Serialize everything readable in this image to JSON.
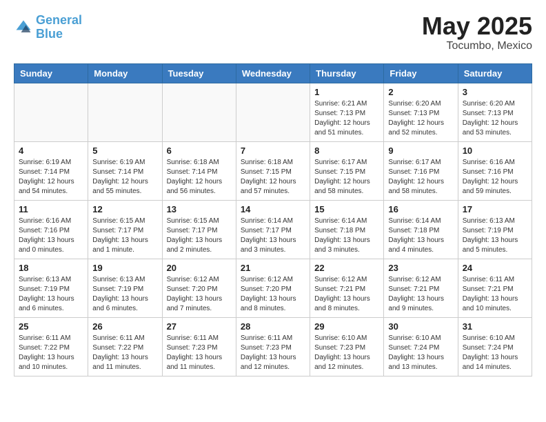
{
  "header": {
    "logo_line1": "General",
    "logo_line2": "Blue",
    "month": "May 2025",
    "location": "Tocumbo, Mexico"
  },
  "weekdays": [
    "Sunday",
    "Monday",
    "Tuesday",
    "Wednesday",
    "Thursday",
    "Friday",
    "Saturday"
  ],
  "weeks": [
    [
      {
        "day": "",
        "info": ""
      },
      {
        "day": "",
        "info": ""
      },
      {
        "day": "",
        "info": ""
      },
      {
        "day": "",
        "info": ""
      },
      {
        "day": "1",
        "info": "Sunrise: 6:21 AM\nSunset: 7:13 PM\nDaylight: 12 hours\nand 51 minutes."
      },
      {
        "day": "2",
        "info": "Sunrise: 6:20 AM\nSunset: 7:13 PM\nDaylight: 12 hours\nand 52 minutes."
      },
      {
        "day": "3",
        "info": "Sunrise: 6:20 AM\nSunset: 7:13 PM\nDaylight: 12 hours\nand 53 minutes."
      }
    ],
    [
      {
        "day": "4",
        "info": "Sunrise: 6:19 AM\nSunset: 7:14 PM\nDaylight: 12 hours\nand 54 minutes."
      },
      {
        "day": "5",
        "info": "Sunrise: 6:19 AM\nSunset: 7:14 PM\nDaylight: 12 hours\nand 55 minutes."
      },
      {
        "day": "6",
        "info": "Sunrise: 6:18 AM\nSunset: 7:14 PM\nDaylight: 12 hours\nand 56 minutes."
      },
      {
        "day": "7",
        "info": "Sunrise: 6:18 AM\nSunset: 7:15 PM\nDaylight: 12 hours\nand 57 minutes."
      },
      {
        "day": "8",
        "info": "Sunrise: 6:17 AM\nSunset: 7:15 PM\nDaylight: 12 hours\nand 58 minutes."
      },
      {
        "day": "9",
        "info": "Sunrise: 6:17 AM\nSunset: 7:16 PM\nDaylight: 12 hours\nand 58 minutes."
      },
      {
        "day": "10",
        "info": "Sunrise: 6:16 AM\nSunset: 7:16 PM\nDaylight: 12 hours\nand 59 minutes."
      }
    ],
    [
      {
        "day": "11",
        "info": "Sunrise: 6:16 AM\nSunset: 7:16 PM\nDaylight: 13 hours\nand 0 minutes."
      },
      {
        "day": "12",
        "info": "Sunrise: 6:15 AM\nSunset: 7:17 PM\nDaylight: 13 hours\nand 1 minute."
      },
      {
        "day": "13",
        "info": "Sunrise: 6:15 AM\nSunset: 7:17 PM\nDaylight: 13 hours\nand 2 minutes."
      },
      {
        "day": "14",
        "info": "Sunrise: 6:14 AM\nSunset: 7:17 PM\nDaylight: 13 hours\nand 3 minutes."
      },
      {
        "day": "15",
        "info": "Sunrise: 6:14 AM\nSunset: 7:18 PM\nDaylight: 13 hours\nand 3 minutes."
      },
      {
        "day": "16",
        "info": "Sunrise: 6:14 AM\nSunset: 7:18 PM\nDaylight: 13 hours\nand 4 minutes."
      },
      {
        "day": "17",
        "info": "Sunrise: 6:13 AM\nSunset: 7:19 PM\nDaylight: 13 hours\nand 5 minutes."
      }
    ],
    [
      {
        "day": "18",
        "info": "Sunrise: 6:13 AM\nSunset: 7:19 PM\nDaylight: 13 hours\nand 6 minutes."
      },
      {
        "day": "19",
        "info": "Sunrise: 6:13 AM\nSunset: 7:19 PM\nDaylight: 13 hours\nand 6 minutes."
      },
      {
        "day": "20",
        "info": "Sunrise: 6:12 AM\nSunset: 7:20 PM\nDaylight: 13 hours\nand 7 minutes."
      },
      {
        "day": "21",
        "info": "Sunrise: 6:12 AM\nSunset: 7:20 PM\nDaylight: 13 hours\nand 8 minutes."
      },
      {
        "day": "22",
        "info": "Sunrise: 6:12 AM\nSunset: 7:21 PM\nDaylight: 13 hours\nand 8 minutes."
      },
      {
        "day": "23",
        "info": "Sunrise: 6:12 AM\nSunset: 7:21 PM\nDaylight: 13 hours\nand 9 minutes."
      },
      {
        "day": "24",
        "info": "Sunrise: 6:11 AM\nSunset: 7:21 PM\nDaylight: 13 hours\nand 10 minutes."
      }
    ],
    [
      {
        "day": "25",
        "info": "Sunrise: 6:11 AM\nSunset: 7:22 PM\nDaylight: 13 hours\nand 10 minutes."
      },
      {
        "day": "26",
        "info": "Sunrise: 6:11 AM\nSunset: 7:22 PM\nDaylight: 13 hours\nand 11 minutes."
      },
      {
        "day": "27",
        "info": "Sunrise: 6:11 AM\nSunset: 7:23 PM\nDaylight: 13 hours\nand 11 minutes."
      },
      {
        "day": "28",
        "info": "Sunrise: 6:11 AM\nSunset: 7:23 PM\nDaylight: 13 hours\nand 12 minutes."
      },
      {
        "day": "29",
        "info": "Sunrise: 6:10 AM\nSunset: 7:23 PM\nDaylight: 13 hours\nand 12 minutes."
      },
      {
        "day": "30",
        "info": "Sunrise: 6:10 AM\nSunset: 7:24 PM\nDaylight: 13 hours\nand 13 minutes."
      },
      {
        "day": "31",
        "info": "Sunrise: 6:10 AM\nSunset: 7:24 PM\nDaylight: 13 hours\nand 14 minutes."
      }
    ]
  ]
}
